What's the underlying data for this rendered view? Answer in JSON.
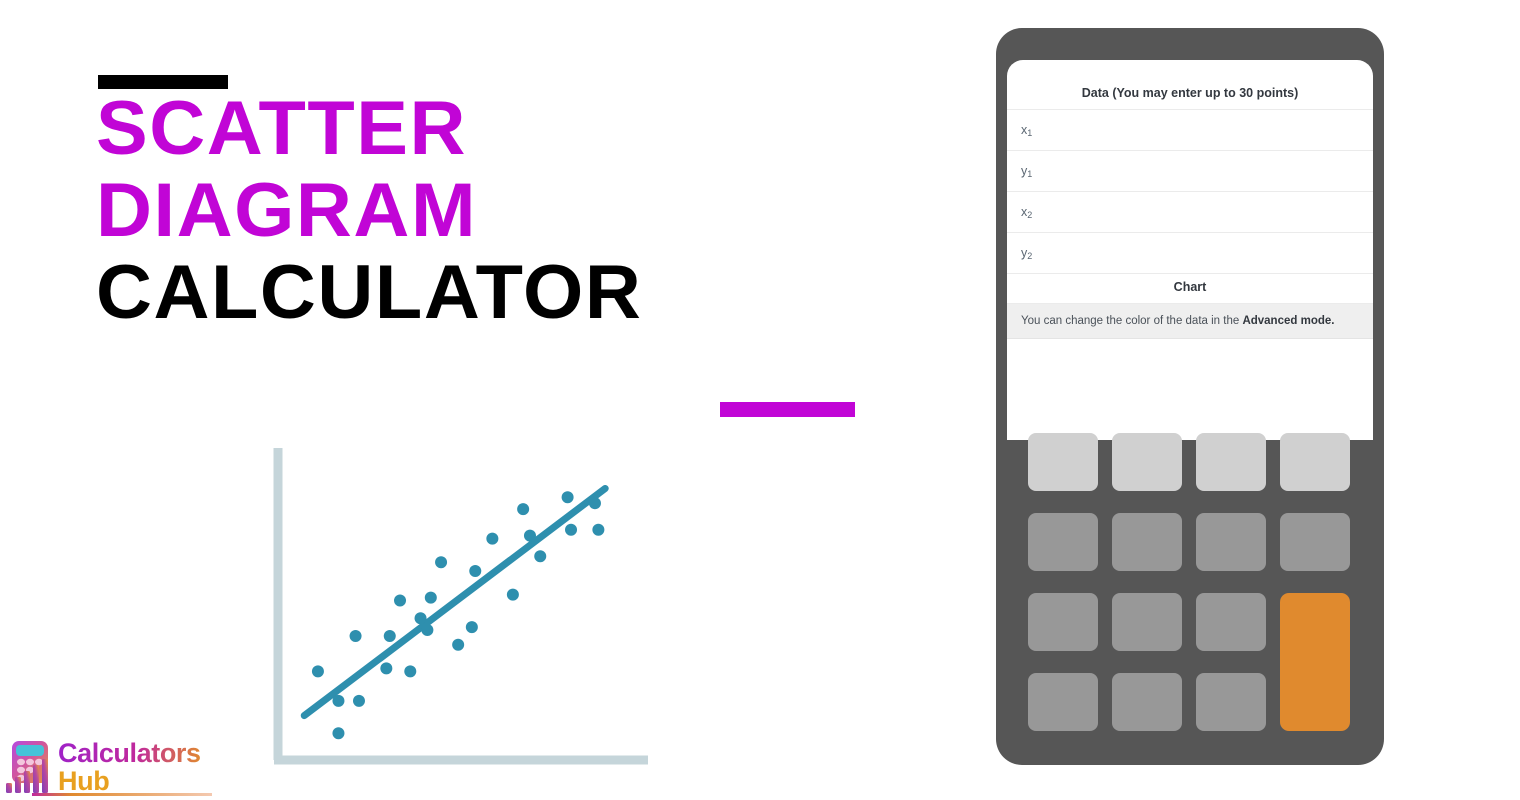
{
  "hero": {
    "title_lines": [
      {
        "text": "Scatter",
        "color": "#c105d6"
      },
      {
        "text": "Diagram",
        "color": "#c105d6"
      },
      {
        "text": "Calculator",
        "color": "#000000"
      }
    ],
    "accent_bar_top_color": "#000000",
    "accent_bar_bottom_color": "#c105d6"
  },
  "logo": {
    "word_one": "Calculators",
    "word_two": "Hub",
    "colors": {
      "gradient_start": "#9f22c8",
      "gradient_end": "#e08a2e",
      "hub": "#e8a020"
    }
  },
  "calculator": {
    "frame_color": "#565656",
    "key_color": "#989898",
    "key_light_color": "#d0d0d0",
    "key_accent_color": "#e08a2e",
    "screen": {
      "heading": "Data (You may enter up to 30 points)",
      "fields": [
        {
          "label": "x",
          "sub": "1",
          "value": "",
          "placeholder": ""
        },
        {
          "label": "y",
          "sub": "1",
          "value": "",
          "placeholder": ""
        },
        {
          "label": "x",
          "sub": "2",
          "value": "",
          "placeholder": ""
        },
        {
          "label": "y",
          "sub": "2",
          "value": "",
          "placeholder": ""
        }
      ],
      "chart_heading": "Chart",
      "note_prefix": "You can change the color of the data in the ",
      "note_emphasis": "Advanced mode."
    },
    "keys": [
      {
        "style": "light"
      },
      {
        "style": "light"
      },
      {
        "style": "light"
      },
      {
        "style": "light"
      },
      {
        "style": "normal"
      },
      {
        "style": "normal"
      },
      {
        "style": "normal"
      },
      {
        "style": "normal"
      },
      {
        "style": "normal"
      },
      {
        "style": "normal"
      },
      {
        "style": "normal"
      },
      {
        "style": "accent"
      },
      {
        "style": "normal"
      },
      {
        "style": "normal"
      },
      {
        "style": "normal"
      }
    ]
  },
  "chart_data": {
    "type": "scatter",
    "title": "",
    "xlabel": "",
    "ylabel": "",
    "xlim": [
      0,
      100
    ],
    "ylim": [
      0,
      100
    ],
    "grid": false,
    "legend": null,
    "point_color": "#2e8fae",
    "line_color": "#2e8fae",
    "axis_color": "#c5d5da",
    "points": [
      {
        "x": 7,
        "y": 27
      },
      {
        "x": 13,
        "y": 17
      },
      {
        "x": 13,
        "y": 6
      },
      {
        "x": 19,
        "y": 17
      },
      {
        "x": 18,
        "y": 39
      },
      {
        "x": 27,
        "y": 28
      },
      {
        "x": 28,
        "y": 39
      },
      {
        "x": 34,
        "y": 27
      },
      {
        "x": 31,
        "y": 51
      },
      {
        "x": 37,
        "y": 45
      },
      {
        "x": 39,
        "y": 41
      },
      {
        "x": 40,
        "y": 52
      },
      {
        "x": 43,
        "y": 64
      },
      {
        "x": 48,
        "y": 36
      },
      {
        "x": 52,
        "y": 42
      },
      {
        "x": 53,
        "y": 61
      },
      {
        "x": 58,
        "y": 72
      },
      {
        "x": 64,
        "y": 53
      },
      {
        "x": 67,
        "y": 82
      },
      {
        "x": 69,
        "y": 73
      },
      {
        "x": 72,
        "y": 66
      },
      {
        "x": 80,
        "y": 86
      },
      {
        "x": 81,
        "y": 75
      },
      {
        "x": 88,
        "y": 84
      },
      {
        "x": 89,
        "y": 75
      }
    ],
    "trendline": {
      "x0": 3,
      "y0": 12,
      "x1": 91,
      "y1": 89
    }
  }
}
